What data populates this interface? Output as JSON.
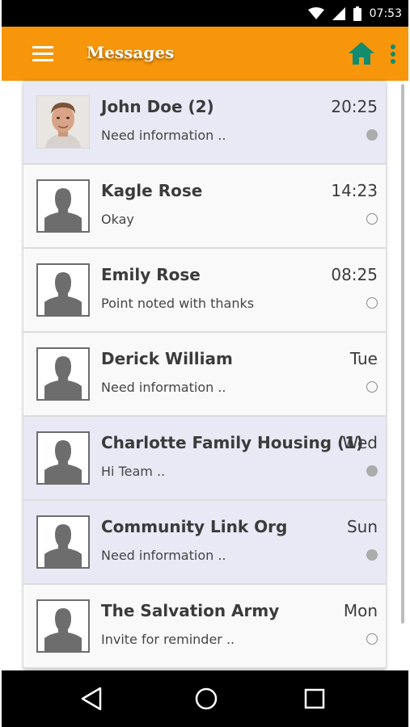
{
  "status_bar": {
    "time": "07:53",
    "icons": [
      "wifi-icon",
      "signal-icon",
      "battery-icon"
    ]
  },
  "app_bar": {
    "title": "Messages",
    "menu_icon": "hamburger-menu-icon",
    "home_icon": "home-icon",
    "more_icon": "more-vert-icon",
    "background": "#f7960b",
    "accent": "#128b6f"
  },
  "messages": [
    {
      "name": "John Doe (2)",
      "preview": "Need information ..",
      "time": "20:25",
      "unread": true,
      "avatar": "photo"
    },
    {
      "name": "Kagle Rose",
      "preview": "Okay",
      "time": "14:23",
      "unread": false,
      "avatar": "placeholder"
    },
    {
      "name": "Emily Rose",
      "preview": "Point noted with thanks",
      "time": "08:25",
      "unread": false,
      "avatar": "placeholder"
    },
    {
      "name": "Derick William",
      "preview": "Need information ..",
      "time": "Tue",
      "unread": false,
      "avatar": "placeholder"
    },
    {
      "name": "Charlotte Family Housing (1)",
      "preview": "Hi Team ..",
      "time": "Wed",
      "unread": true,
      "avatar": "placeholder"
    },
    {
      "name": "Community Link Org",
      "preview": "Need information ..",
      "time": "Sun",
      "unread": true,
      "avatar": "placeholder"
    },
    {
      "name": "The Salvation Army",
      "preview": "Invite for reminder ..",
      "time": "Mon",
      "unread": false,
      "avatar": "placeholder"
    }
  ],
  "nav_bar": {
    "icons": [
      "back-triangle-icon",
      "home-circle-icon",
      "recents-square-icon"
    ]
  }
}
